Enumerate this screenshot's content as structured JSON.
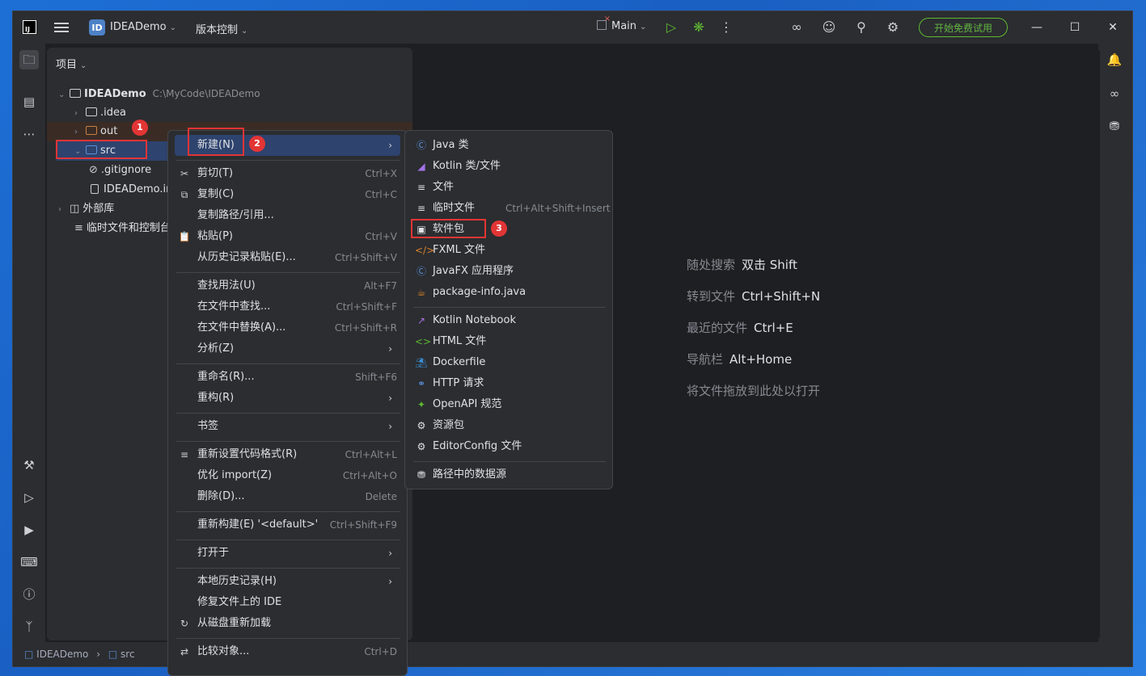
{
  "titlebar": {
    "logo": "IJ",
    "project_badge": "ID",
    "project_name": "IDEADemo",
    "vcs": "版本控制",
    "run_config": "Main",
    "trial_button": "开始免费试用"
  },
  "project_panel": {
    "title": "项目",
    "root": "IDEADemo",
    "root_path": "C:\\MyCode\\IDEADemo",
    "items": [
      ".idea",
      "out",
      "src",
      ".gitignore",
      "IDEADemo.iml",
      "外部库",
      "临时文件和控制台"
    ]
  },
  "badges": [
    "1",
    "2",
    "3"
  ],
  "context_menu": {
    "items": [
      {
        "label": "新建(N)",
        "shortcut": ""
      },
      {
        "label": "剪切(T)",
        "shortcut": "Ctrl+X"
      },
      {
        "label": "复制(C)",
        "shortcut": "Ctrl+C"
      },
      {
        "label": "复制路径/引用...",
        "shortcut": ""
      },
      {
        "label": "粘贴(P)",
        "shortcut": "Ctrl+V"
      },
      {
        "label": "从历史记录粘贴(E)...",
        "shortcut": "Ctrl+Shift+V"
      },
      {
        "label": "查找用法(U)",
        "shortcut": "Alt+F7"
      },
      {
        "label": "在文件中查找...",
        "shortcut": "Ctrl+Shift+F"
      },
      {
        "label": "在文件中替换(A)...",
        "shortcut": "Ctrl+Shift+R"
      },
      {
        "label": "分析(Z)",
        "shortcut": ""
      },
      {
        "label": "重命名(R)...",
        "shortcut": "Shift+F6"
      },
      {
        "label": "重构(R)",
        "shortcut": ""
      },
      {
        "label": "书签",
        "shortcut": ""
      },
      {
        "label": "重新设置代码格式(R)",
        "shortcut": "Ctrl+Alt+L"
      },
      {
        "label": "优化 import(Z)",
        "shortcut": "Ctrl+Alt+O"
      },
      {
        "label": "删除(D)...",
        "shortcut": "Delete"
      },
      {
        "label": "重新构建(E) '<default>'",
        "shortcut": "Ctrl+Shift+F9"
      },
      {
        "label": "打开于",
        "shortcut": ""
      },
      {
        "label": "本地历史记录(H)",
        "shortcut": ""
      },
      {
        "label": "修复文件上的 IDE",
        "shortcut": ""
      },
      {
        "label": "从磁盘重新加载",
        "shortcut": ""
      },
      {
        "label": "比较对象...",
        "shortcut": "Ctrl+D"
      }
    ]
  },
  "new_submenu": {
    "items": [
      {
        "label": "Java 类",
        "shortcut": ""
      },
      {
        "label": "Kotlin 类/文件",
        "shortcut": ""
      },
      {
        "label": "文件",
        "shortcut": ""
      },
      {
        "label": "临时文件",
        "shortcut": "Ctrl+Alt+Shift+Insert"
      },
      {
        "label": "软件包",
        "shortcut": ""
      },
      {
        "label": "FXML 文件",
        "shortcut": ""
      },
      {
        "label": "JavaFX 应用程序",
        "shortcut": ""
      },
      {
        "label": "package-info.java",
        "shortcut": ""
      },
      {
        "label": "Kotlin Notebook",
        "shortcut": ""
      },
      {
        "label": "HTML 文件",
        "shortcut": ""
      },
      {
        "label": "Dockerfile",
        "shortcut": ""
      },
      {
        "label": "HTTP 请求",
        "shortcut": ""
      },
      {
        "label": "OpenAPI 规范",
        "shortcut": ""
      },
      {
        "label": "资源包",
        "shortcut": ""
      },
      {
        "label": "EditorConfig 文件",
        "shortcut": ""
      },
      {
        "label": "路径中的数据源",
        "shortcut": ""
      }
    ]
  },
  "editor_hints": [
    {
      "label": "随处搜索",
      "key": "双击 Shift"
    },
    {
      "label": "转到文件",
      "key": "Ctrl+Shift+N"
    },
    {
      "label": "最近的文件",
      "key": "Ctrl+E"
    },
    {
      "label": "导航栏",
      "key": "Alt+Home"
    },
    {
      "label": "将文件拖放到此处以打开",
      "key": ""
    }
  ],
  "statusbar": {
    "crumbs": [
      "IDEADemo",
      "src"
    ]
  }
}
